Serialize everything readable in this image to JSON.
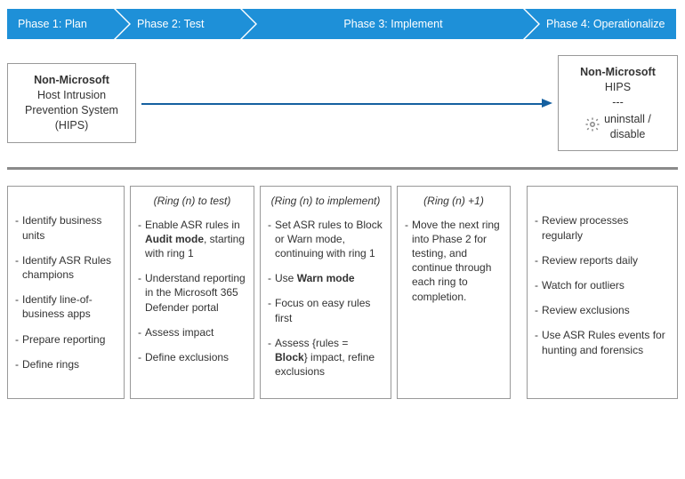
{
  "phases": {
    "p1": "Phase 1: Plan",
    "p2": "Phase 2: Test",
    "p3": "Phase 3: Implement",
    "p4": "Phase 4: Operationalize"
  },
  "flow": {
    "left_title": "Non-Microsoft",
    "left_sub1": "Host Intrusion",
    "left_sub2": "Prevention System",
    "left_sub3": "(HIPS)",
    "right_title": "Non-Microsoft",
    "right_sub1": "HIPS",
    "right_sep": "---",
    "right_action1": "uninstall /",
    "right_action2": "disable"
  },
  "col1": {
    "i1": "Identify business units",
    "i2": "Identify ASR Rules champions",
    "i3": "Identify line-of-business apps",
    "i4": "Prepare reporting",
    "i5": "Define rings"
  },
  "col2": {
    "header": "(Ring (n) to test)",
    "i1a": "Enable ASR rules in ",
    "i1b": "Audit mode",
    "i1c": ", starting with ring 1",
    "i2": "Understand reporting in the Microsoft 365 Defender portal",
    "i3": "Assess impact",
    "i4": "Define exclusions"
  },
  "col3": {
    "header": "(Ring (n) to implement)",
    "i1": "Set ASR rules to Block or Warn mode, continuing with ring 1",
    "i2a": "Use ",
    "i2b": "Warn mode",
    "i3": "Focus on easy rules first",
    "i4a": "Assess  {rules = ",
    "i4b": "Block",
    "i4c": "} impact, refine exclusions"
  },
  "col4": {
    "header": "(Ring (n) +1)",
    "i1": "Move the next ring into Phase 2 for testing, and continue through each ring to completion."
  },
  "col5": {
    "i1": "Review processes regularly",
    "i2": "Review reports daily",
    "i3": "Watch for outliers",
    "i4": "Review exclusions",
    "i5": "Use ASR Rules events for hunting and forensics"
  }
}
